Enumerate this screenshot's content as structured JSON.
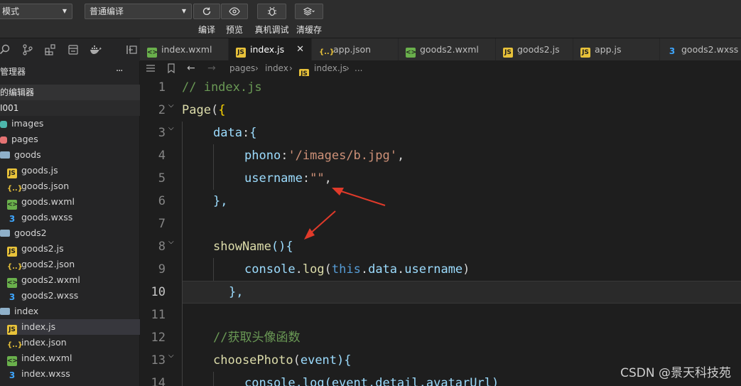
{
  "toolbar": {
    "mode_value": "模式",
    "compile_value": "普通编译",
    "buttons": [
      "编译",
      "预览",
      "真机调试",
      "清缓存"
    ],
    "button_icons": [
      "refresh-icon",
      "eye-icon",
      "bug-icon",
      "layers-icon"
    ]
  },
  "activity_icons": [
    "search-icon",
    "source-control-icon",
    "extensions-icon",
    "storage-icon",
    "docker-icon",
    "split-panel-icon"
  ],
  "explorer": {
    "title": "管理器",
    "menu": "···",
    "open_editors": "的编辑器",
    "project": "I001",
    "items": [
      {
        "label": "images",
        "type": "img"
      },
      {
        "label": "pages",
        "type": "pages"
      },
      {
        "label": "goods",
        "type": "folder"
      },
      {
        "label": "goods.js",
        "type": "js"
      },
      {
        "label": "goods.json",
        "type": "json"
      },
      {
        "label": "goods.wxml",
        "type": "wxml"
      },
      {
        "label": "goods.wxss",
        "type": "wxss"
      },
      {
        "label": "goods2",
        "type": "folder"
      },
      {
        "label": "goods2.js",
        "type": "js"
      },
      {
        "label": "goods2.json",
        "type": "json"
      },
      {
        "label": "goods2.wxml",
        "type": "wxml"
      },
      {
        "label": "goods2.wxss",
        "type": "wxss"
      },
      {
        "label": "index",
        "type": "folder"
      },
      {
        "label": "index.js",
        "type": "js",
        "selected": true
      },
      {
        "label": "index.json",
        "type": "json"
      },
      {
        "label": "index.wxml",
        "type": "wxml"
      },
      {
        "label": "index.wxss",
        "type": "wxss"
      }
    ]
  },
  "tabs": [
    {
      "label": "index.wxml",
      "type": "wxml"
    },
    {
      "label": "index.js",
      "type": "js",
      "active": true,
      "close": "✕"
    },
    {
      "label": "app.json",
      "type": "json"
    },
    {
      "label": "goods2.wxml",
      "type": "wxml"
    },
    {
      "label": "goods2.js",
      "type": "js"
    },
    {
      "label": "app.js",
      "type": "js"
    },
    {
      "label": "goods2.wxss",
      "type": "wxss"
    }
  ],
  "breadcrumb": {
    "parts": [
      "pages",
      "index",
      "index.js",
      "..."
    ]
  },
  "editor": {
    "line_numbers": [
      "1",
      "2",
      "3",
      "4",
      "5",
      "6",
      "7",
      "8",
      "9",
      "10",
      "11",
      "12",
      "13",
      "14"
    ],
    "current_line": "10",
    "lines": {
      "l1": "// index.js",
      "l2a": "Page",
      "l2b": "(",
      "l2c": "{",
      "l3a": "data",
      "l3b": ":",
      "l3c": "{",
      "l4a": "phono",
      "l4b": ":",
      "l4c": "'/images/b.jpg'",
      "l4d": ",",
      "l5a": "username",
      "l5b": ":",
      "l5c": "\"\"",
      "l5d": ",",
      "l6": "},",
      "l8a": "showName",
      "l8b": "(){",
      "l9a": "console",
      "l9b": ".",
      "l9c": "log",
      "l9d": "(",
      "l9e": "this",
      "l9f": ".",
      "l9g": "data",
      "l9h": ".",
      "l9i": "username",
      "l9j": ")",
      "l10": "},",
      "l12": "//获取头像函数",
      "l13a": "choosePhoto",
      "l13b": "(",
      "l13c": "event",
      "l13d": "){",
      "l14": "console.log(event.detail.avatarUrl)"
    }
  },
  "watermark": "CSDN @景天科技苑",
  "annotation_color": "#e03a2a"
}
